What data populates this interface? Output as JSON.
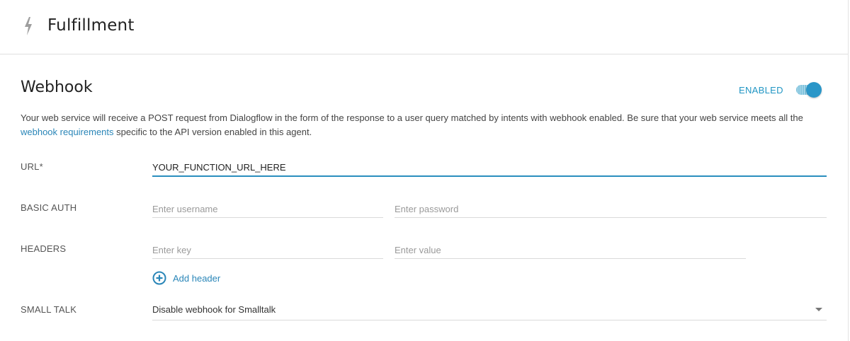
{
  "header": {
    "title": "Fulfillment",
    "icon": "bolt-icon"
  },
  "webhook": {
    "title": "Webhook",
    "status_label": "ENABLED",
    "enabled": true,
    "description_before_link": "Your web service will receive a POST request from Dialogflow in the form of the response to a user query matched by intents with webhook enabled. Be sure that your web service meets all the ",
    "description_link": "webhook requirements",
    "description_after_link": " specific to the API version enabled in this agent."
  },
  "fields": {
    "url": {
      "label": "URL*",
      "value": "YOUR_FUNCTION_URL_HERE"
    },
    "basic_auth": {
      "label": "BASIC AUTH",
      "username_placeholder": "Enter username",
      "password_placeholder": "Enter password"
    },
    "headers": {
      "label": "HEADERS",
      "key_placeholder": "Enter key",
      "value_placeholder": "Enter value",
      "add_label": "Add header"
    },
    "small_talk": {
      "label": "SMALL TALK",
      "selected": "Disable webhook for Smalltalk"
    }
  },
  "colors": {
    "accent": "#2a96c8",
    "link": "#2a86b8"
  }
}
